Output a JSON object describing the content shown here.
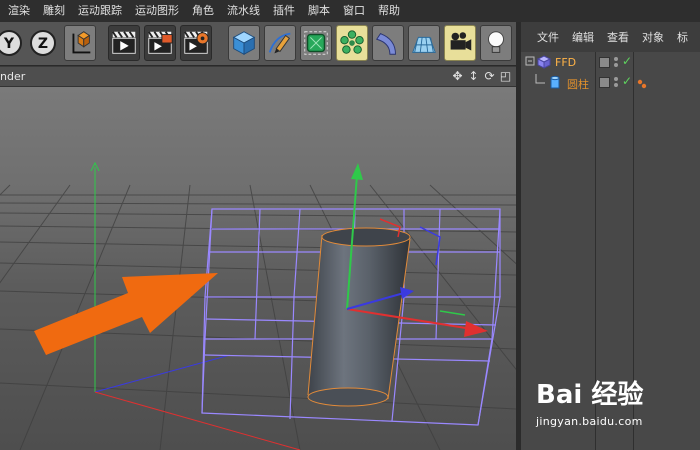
{
  "menu": {
    "items": [
      "渲染",
      "雕刻",
      "运动跟踪",
      "运动图形",
      "角色",
      "流水线",
      "插件",
      "脚本",
      "窗口",
      "帮助"
    ]
  },
  "toolbar": {
    "axis_labels": [
      "Y",
      "Z"
    ],
    "icons": [
      "world-coordinates-icon",
      "render-view-icon",
      "render-picture-viewer-icon",
      "render-settings-icon",
      "cube-icon",
      "pen-spline-icon",
      "subdivision-icon",
      "cloner-icon",
      "deformer-icon",
      "floor-icon",
      "camera-icon",
      "light-icon"
    ]
  },
  "viewport": {
    "header_label": "nder",
    "nav_icons": [
      "move-view-icon",
      "zoom-view-icon",
      "rotate-view-icon",
      "maximize-view-icon"
    ],
    "colors": {
      "y_axis": "#2fc94a",
      "x_axis": "#e03030",
      "z_axis": "#3a3ae0",
      "ffd_lattice": "#9a88ff",
      "annotation_arrow": "#f06a10"
    }
  },
  "object_manager": {
    "menu_items": [
      "文件",
      "编辑",
      "查看",
      "对象",
      "标"
    ],
    "objects": [
      {
        "name": "FFD",
        "color": "#ffb347",
        "icon": "ffd-icon"
      },
      {
        "name": "圆柱",
        "color": "#e0902c",
        "icon": "cylinder-icon"
      }
    ]
  },
  "watermark": {
    "logo": "Bai 经验",
    "url": "jingyan.baidu.com"
  }
}
